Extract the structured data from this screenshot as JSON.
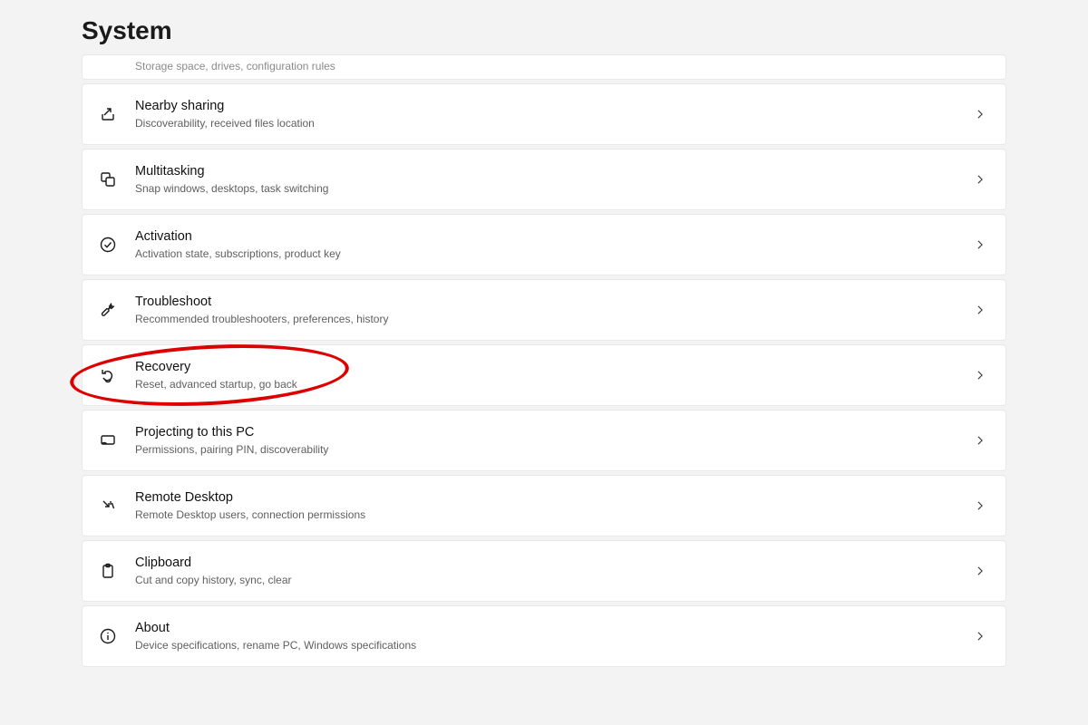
{
  "page_title": "System",
  "items": [
    {
      "title": "",
      "desc": "Storage space, drives, configuration rules",
      "icon": "storage-icon",
      "clipped": true
    },
    {
      "title": "Nearby sharing",
      "desc": "Discoverability, received files location",
      "icon": "share-icon"
    },
    {
      "title": "Multitasking",
      "desc": "Snap windows, desktops, task switching",
      "icon": "multitasking-icon"
    },
    {
      "title": "Activation",
      "desc": "Activation state, subscriptions, product key",
      "icon": "checkmark-circle-icon"
    },
    {
      "title": "Troubleshoot",
      "desc": "Recommended troubleshooters, preferences, history",
      "icon": "wrench-icon"
    },
    {
      "title": "Recovery",
      "desc": "Reset, advanced startup, go back",
      "icon": "recovery-icon",
      "highlight": true
    },
    {
      "title": "Projecting to this PC",
      "desc": "Permissions, pairing PIN, discoverability",
      "icon": "projecting-icon"
    },
    {
      "title": "Remote Desktop",
      "desc": "Remote Desktop users, connection permissions",
      "icon": "remote-desktop-icon"
    },
    {
      "title": "Clipboard",
      "desc": "Cut and copy history, sync, clear",
      "icon": "clipboard-icon"
    },
    {
      "title": "About",
      "desc": "Device specifications, rename PC, Windows specifications",
      "icon": "info-icon"
    }
  ],
  "annotation": {
    "color": "#d00000"
  }
}
